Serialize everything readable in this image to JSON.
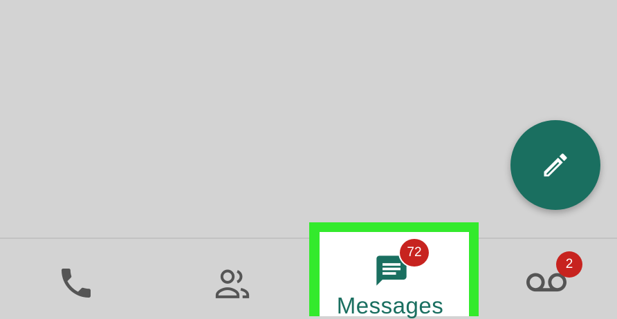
{
  "fab": {
    "icon": "pencil-icon",
    "color": "#1a6f60"
  },
  "bottom_nav": {
    "items": [
      {
        "id": "calls",
        "icon": "phone-icon"
      },
      {
        "id": "contacts",
        "icon": "people-icon"
      },
      {
        "id": "messages",
        "icon": "message-icon",
        "label": "Messages",
        "badge": "72",
        "selected": true,
        "highlighted": true
      },
      {
        "id": "voicemail",
        "icon": "voicemail-icon",
        "badge": "2"
      }
    ]
  },
  "colors": {
    "background": "#d3d3d3",
    "accent": "#1a6f60",
    "badge": "#c7231f",
    "highlight": "#33ea2c",
    "icon": "#555555"
  }
}
